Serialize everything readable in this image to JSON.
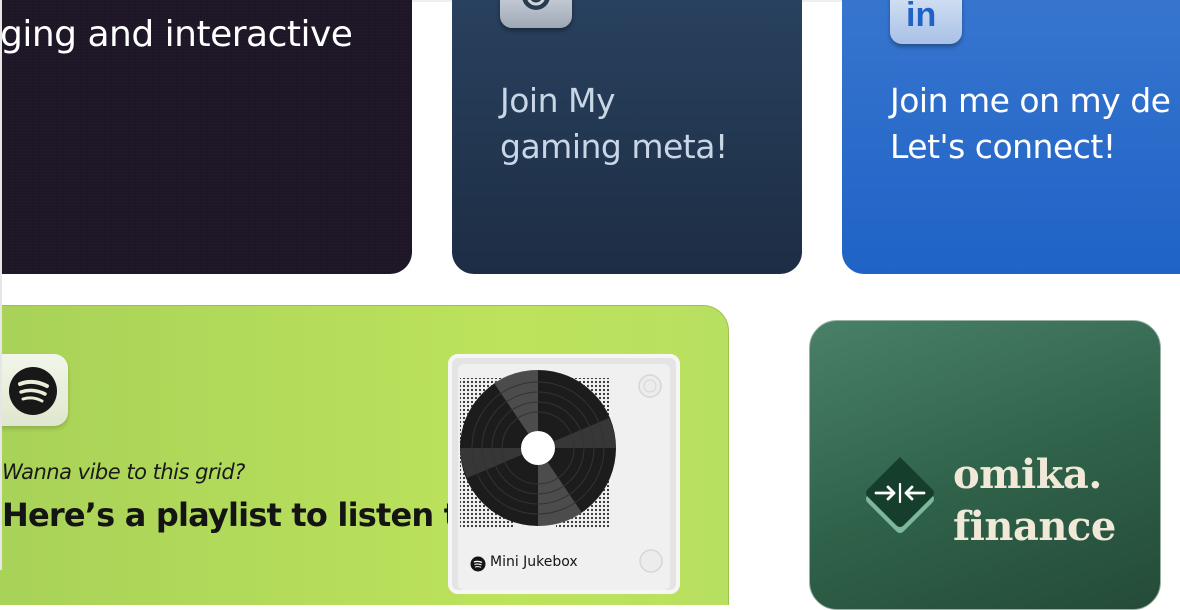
{
  "cards": {
    "intro": {
      "text": "ging and interactive"
    },
    "steam": {
      "line1": "Join My",
      "line2": "gaming meta!",
      "icon": "steam-icon"
    },
    "linkedin": {
      "line1": "Join me on my de",
      "line2": "Let's connect!",
      "icon": "linkedin-icon",
      "icon_glyph": "in"
    },
    "spotify": {
      "subtitle": "Wanna vibe to this grid?",
      "headline": "Here’s a playlist to listen to",
      "icon": "spotify-icon",
      "player_title": "Mini Jukebox"
    },
    "omika": {
      "line1": "omika.",
      "line2": "finance",
      "icon": "omika-logo-icon"
    }
  },
  "colors": {
    "dark_card": "#1d1626",
    "steam_card": "#243a55",
    "linkedin_card": "#2b6ccb",
    "spotify_card": "#b5dc5a",
    "omika_card": "#2f6149",
    "omika_text": "#f1e8d8"
  }
}
